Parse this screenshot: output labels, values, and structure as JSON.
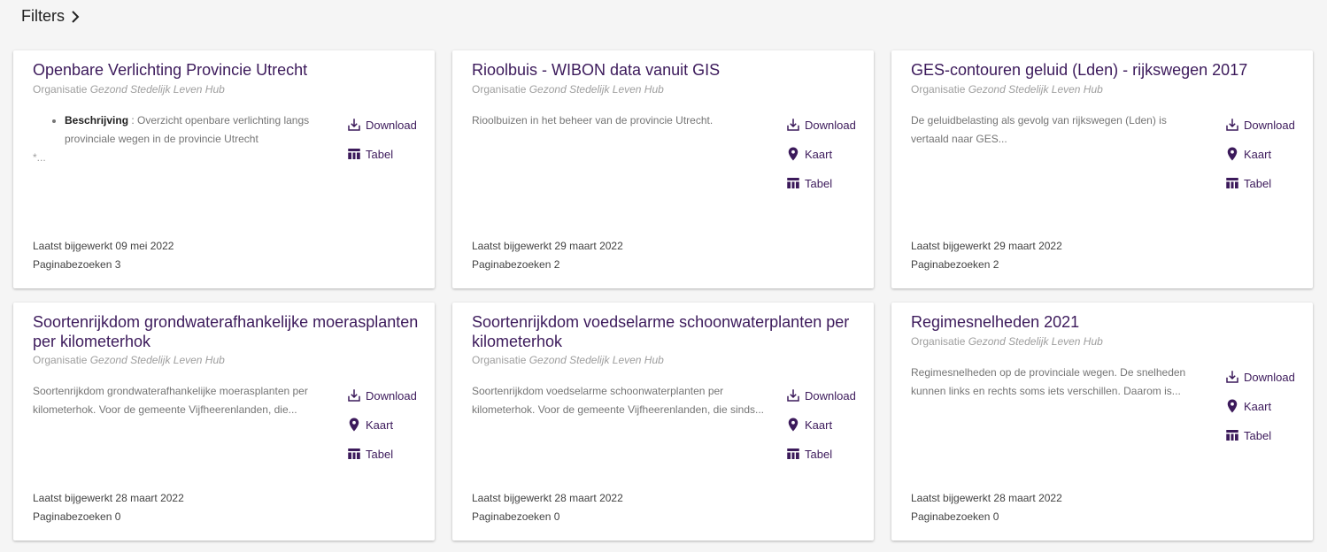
{
  "filters_label": "Filters",
  "actions": {
    "download": "Download",
    "kaart": "Kaart",
    "tabel": "Tabel"
  },
  "org_label": "Organisatie",
  "updated_label": "Laatst bijgewerkt",
  "visits_label": "Paginabezoeken",
  "colors": {
    "accent": "#3c1a5b",
    "background": "#f5f5f5",
    "card": "#ffffff"
  },
  "cards": [
    {
      "title": "Openbare Verlichting Provincie Utrecht",
      "org": "Gezond Stedelijk Leven Hub",
      "desc_label": "Beschrijving",
      "desc": " : Overzicht openbare verlichting langs provinciale wegen in de provincie Utrecht",
      "desc_extra": "*...",
      "updated": "09 mei 2022",
      "visits": "3"
    },
    {
      "title": "Rioolbuis - WIBON data vanuit GIS",
      "org": "Gezond Stedelijk Leven Hub",
      "desc": "Rioolbuizen in het beheer van de provincie Utrecht.",
      "updated": "29 maart 2022",
      "visits": "2"
    },
    {
      "title": "GES-contouren geluid (Lden) - rijkswegen 2017",
      "org": "Gezond Stedelijk Leven Hub",
      "desc": "De geluidbelasting als gevolg van rijkswegen (Lden) is vertaald naar GES...",
      "updated": "29 maart 2022",
      "visits": "2"
    },
    {
      "title": "Soortenrijkdom grondwaterafhankelijke moerasplanten per kilometerhok",
      "org": "Gezond Stedelijk Leven Hub",
      "desc": "Soortenrijkdom grondwaterafhankelijke moerasplanten per kilometerhok. Voor de gemeente Vijfheerenlanden, die...",
      "updated": "28 maart 2022",
      "visits": "0"
    },
    {
      "title": "Soortenrijkdom voedselarme schoonwaterplanten per kilometerhok",
      "org": "Gezond Stedelijk Leven Hub",
      "desc": "Soortenrijkdom voedselarme schoonwaterplanten per kilometerhok. Voor de gemeente Vijfheerenlanden, die sinds...",
      "updated": "28 maart 2022",
      "visits": "0"
    },
    {
      "title": "Regimesnelheden 2021",
      "org": "Gezond Stedelijk Leven Hub",
      "desc": "Regimesnelheden op de provinciale wegen. De snelheden kunnen links en rechts soms iets verschillen. Daarom is...",
      "updated": "28 maart 2022",
      "visits": "0"
    }
  ]
}
